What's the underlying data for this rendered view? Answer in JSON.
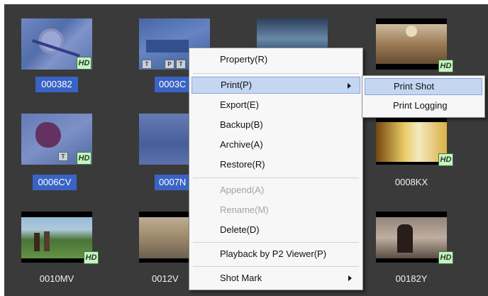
{
  "clips": [
    {
      "name": "000382",
      "selected": true,
      "hd": true,
      "tags": []
    },
    {
      "name": "0003C",
      "selected": true,
      "hd": false,
      "tags": [
        "T",
        "P",
        "T"
      ]
    },
    {
      "name": "",
      "selected": false,
      "hd": false,
      "tags": []
    },
    {
      "name": "",
      "selected": false,
      "hd": true,
      "tags": []
    },
    {
      "name": "0006CV",
      "selected": true,
      "hd": true,
      "tags": [
        "T"
      ]
    },
    {
      "name": "0007N",
      "selected": true,
      "hd": false,
      "tags": []
    },
    {
      "name": "",
      "selected": false,
      "hd": false,
      "tags": []
    },
    {
      "name": "0008KX",
      "selected": false,
      "hd": true,
      "tags": []
    },
    {
      "name": "0010MV",
      "selected": false,
      "hd": true,
      "tags": []
    },
    {
      "name": "0012V",
      "selected": false,
      "hd": false,
      "tags": []
    },
    {
      "name": "",
      "selected": false,
      "hd": false,
      "tags": []
    },
    {
      "name": "00182Y",
      "selected": false,
      "hd": true,
      "tags": []
    }
  ],
  "badges": {
    "hd": "HD"
  },
  "context_menu": {
    "items": [
      {
        "label": "Property(R)",
        "disabled": false,
        "submenu": false
      },
      {
        "label": "Print(P)",
        "disabled": false,
        "submenu": true,
        "highlighted": true
      },
      {
        "label": "Export(E)",
        "disabled": false,
        "submenu": false
      },
      {
        "label": "Backup(B)",
        "disabled": false,
        "submenu": false
      },
      {
        "label": "Archive(A)",
        "disabled": false,
        "submenu": false
      },
      {
        "label": "Restore(R)",
        "disabled": false,
        "submenu": false
      },
      {
        "label": "Append(A)",
        "disabled": true,
        "submenu": false
      },
      {
        "label": "Rename(M)",
        "disabled": true,
        "submenu": false
      },
      {
        "label": "Delete(D)",
        "disabled": false,
        "submenu": false
      },
      {
        "label": "Playback by P2 Viewer(P)",
        "disabled": false,
        "submenu": false
      },
      {
        "label": "Shot Mark",
        "disabled": false,
        "submenu": true
      }
    ]
  },
  "print_submenu": {
    "items": [
      {
        "label": "Print Shot",
        "highlighted": true
      },
      {
        "label": "Print Logging",
        "highlighted": false
      }
    ]
  },
  "colors": {
    "background": "#3a3a3a",
    "selection": "#3a63c6",
    "menu_highlight": "#c5d6f3",
    "hd_badge": "#c9f2c4"
  }
}
